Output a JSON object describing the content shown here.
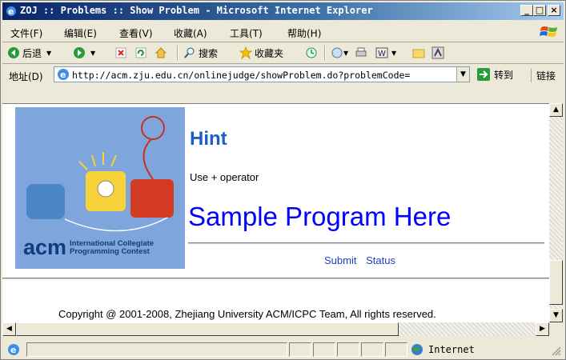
{
  "window": {
    "title": "ZOJ :: Problems :: Show Problem - Microsoft Internet Explorer",
    "controls": {
      "minimize": "_",
      "maximize": "□",
      "close": "×"
    }
  },
  "menu": [
    "文件(F)",
    "编辑(E)",
    "查看(V)",
    "收藏(A)",
    "工具(T)",
    "帮助(H)"
  ],
  "toolbar": {
    "back_label": "后退",
    "search_label": "搜索",
    "favorites_label": "收藏夹"
  },
  "address": {
    "label": "地址(D)",
    "url": "http://acm.zju.edu.cn/onlinejudge/showProblem.do?problemCode=",
    "go_label": "转到",
    "links_label": "链接"
  },
  "page": {
    "hint_title": "Hint",
    "hint_body": "Use + operator",
    "sample_link": "Sample Program Here",
    "submit_link": "Submit",
    "status_link": "Status",
    "copyright": "Copyright @ 2001-2008, Zhejiang University ACM/ICPC Team, All rights reserved.",
    "logo": {
      "brand": "acm",
      "line1": "International Collegiate",
      "line2": "Programming Contest"
    }
  },
  "statusbar": {
    "zone": "Internet"
  },
  "colors": {
    "titlebar": "#0a246a",
    "hint": "#1a5fc6",
    "link": "#0000ff",
    "chrome": "#ece9d8"
  }
}
